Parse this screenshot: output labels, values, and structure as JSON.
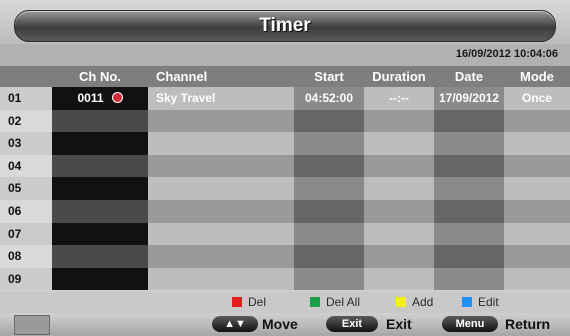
{
  "header": {
    "title": "Timer",
    "datetime": "16/09/2012  10:04:06"
  },
  "table": {
    "columns": [
      "Ch No.",
      "Channel",
      "Start",
      "Duration",
      "Date",
      "Mode"
    ],
    "rows": [
      {
        "num": "01",
        "ch_no": "0011",
        "channel": "Sky Travel",
        "start": "04:52:00",
        "duration": "--:--",
        "date": "17/09/2012",
        "mode": "Once",
        "selected": true
      },
      {
        "num": "02"
      },
      {
        "num": "03"
      },
      {
        "num": "04"
      },
      {
        "num": "05"
      },
      {
        "num": "06"
      },
      {
        "num": "07"
      },
      {
        "num": "08"
      },
      {
        "num": "09"
      }
    ]
  },
  "legend": [
    {
      "label": "Del",
      "color": "#e21d1d"
    },
    {
      "label": "Del All",
      "color": "#1aa04a"
    },
    {
      "label": "Add",
      "color": "#f4ee1f"
    },
    {
      "label": "Edit",
      "color": "#1e90ff"
    }
  ],
  "footer": {
    "move_key": "▲▼",
    "move_label": "Move",
    "exit_key": "Exit",
    "exit_label": "Exit",
    "menu_key": "Menu",
    "menu_label": "Return"
  },
  "colors": {
    "selected_row": "#7c92c8",
    "selected_border": "#ffffff",
    "clock_icon": "#d62b3a"
  }
}
